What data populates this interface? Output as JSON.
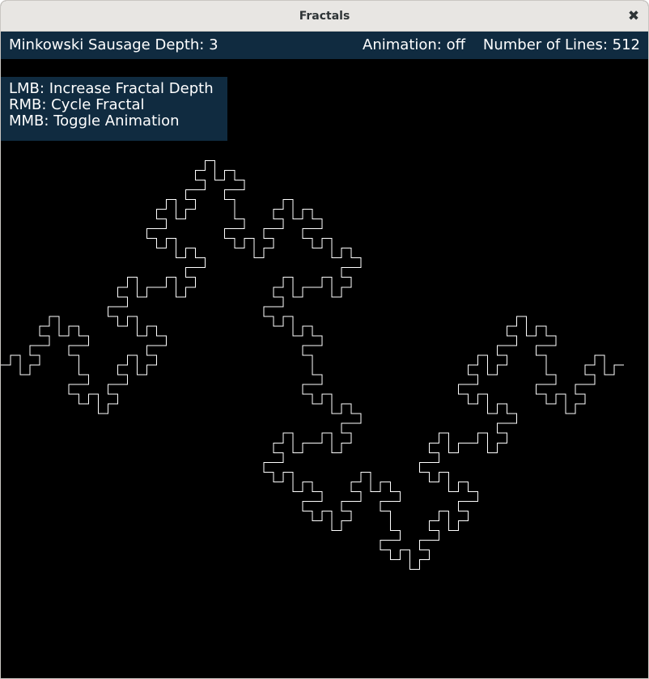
{
  "window": {
    "title": "Fractals",
    "close_icon": "close-icon"
  },
  "hud": {
    "fractal_label": "Minkowski Sausage Depth: 3",
    "animation_label": "Animation: off",
    "lines_label": "Number of Lines: 512"
  },
  "help": {
    "lines": [
      "LMB: Increase Fractal Depth",
      "RMB: Cycle Fractal",
      "MMB: Toggle Animation"
    ]
  },
  "fractal": {
    "name": "Minkowski Sausage",
    "depth": 3,
    "line_color": "#ffffff",
    "background_color": "#000000"
  }
}
